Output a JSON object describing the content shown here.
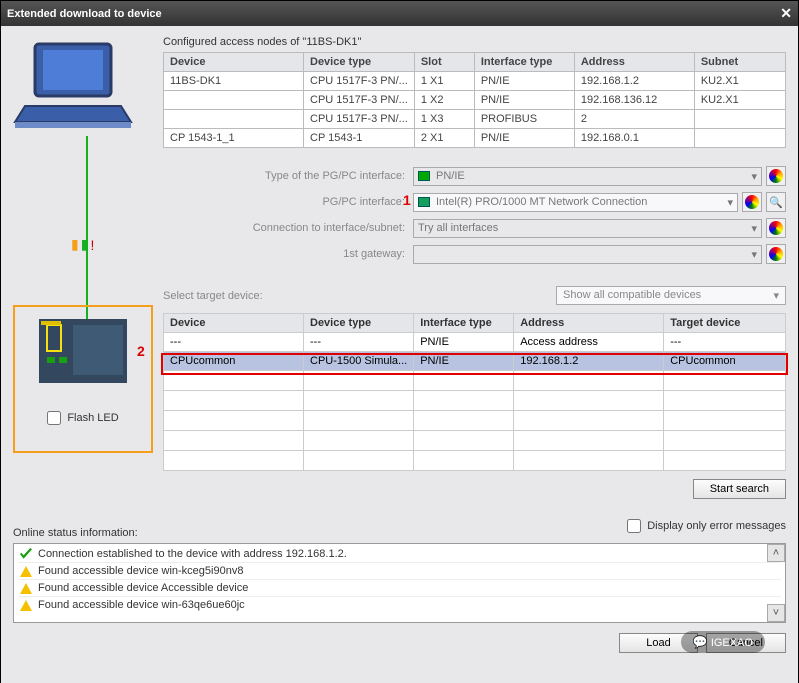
{
  "title": "Extended download to device",
  "caption": "Configured access nodes of \"11BS-DK1\"",
  "access_headers": [
    "Device",
    "Device type",
    "Slot",
    "Interface type",
    "Address",
    "Subnet"
  ],
  "access_rows": [
    {
      "device": "11BS-DK1",
      "dtype": "CPU 1517F-3 PN/...",
      "slot": "1 X1",
      "itype": "PN/IE",
      "addr": "192.168.1.2",
      "subnet": "KU2.X1"
    },
    {
      "device": "",
      "dtype": "CPU 1517F-3 PN/...",
      "slot": "1 X2",
      "itype": "PN/IE",
      "addr": "192.168.136.12",
      "subnet": "KU2.X1"
    },
    {
      "device": "",
      "dtype": "CPU 1517F-3 PN/...",
      "slot": "1 X3",
      "itype": "PROFIBUS",
      "addr": "2",
      "subnet": ""
    },
    {
      "device": "CP 1543-1_1",
      "dtype": "CP 1543-1",
      "slot": "2 X1",
      "itype": "PN/IE",
      "addr": "192.168.0.1",
      "subnet": ""
    }
  ],
  "form": {
    "pgpc_type_label": "Type of the PG/PC interface:",
    "pgpc_type_value": "PN/IE",
    "pgpc_if_label": "PG/PC interface:",
    "pgpc_if_value": "Intel(R) PRO/1000 MT Network Connection",
    "conn_label": "Connection to interface/subnet:",
    "conn_value": "Try all interfaces",
    "gw_label": "1st gateway:",
    "gw_value": ""
  },
  "annotations": {
    "n1": "1",
    "n2": "2"
  },
  "select_label": "Select target device:",
  "select_combo": "Show all compatible devices",
  "target_headers": [
    "Device",
    "Device type",
    "Interface type",
    "Address",
    "Target device"
  ],
  "target_rows": [
    {
      "device": "---",
      "dtype": "---",
      "itype": "PN/IE",
      "addr": "Access address",
      "tdev": "---",
      "sel": false
    },
    {
      "device": "CPUcommon",
      "dtype": "CPU-1500 Simula...",
      "itype": "PN/IE",
      "addr": "192.168.1.2",
      "tdev": "CPUcommon",
      "sel": true
    }
  ],
  "flash_label": "Flash LED",
  "start_search": "Start search",
  "status_label": "Online status information:",
  "error_only": "Display only error messages",
  "status_items": [
    {
      "kind": "ok",
      "text": "Connection established to the device with address 192.168.1.2."
    },
    {
      "kind": "warn",
      "text": "Found accessible device win-kceg5i90nv8"
    },
    {
      "kind": "warn",
      "text": "Found accessible device Accessible device"
    },
    {
      "kind": "warn",
      "text": "Found accessible device win-63qe6ue60jc"
    }
  ],
  "buttons": {
    "load": "Load",
    "cancel": "Cancel"
  },
  "brand": "IGEXAO"
}
